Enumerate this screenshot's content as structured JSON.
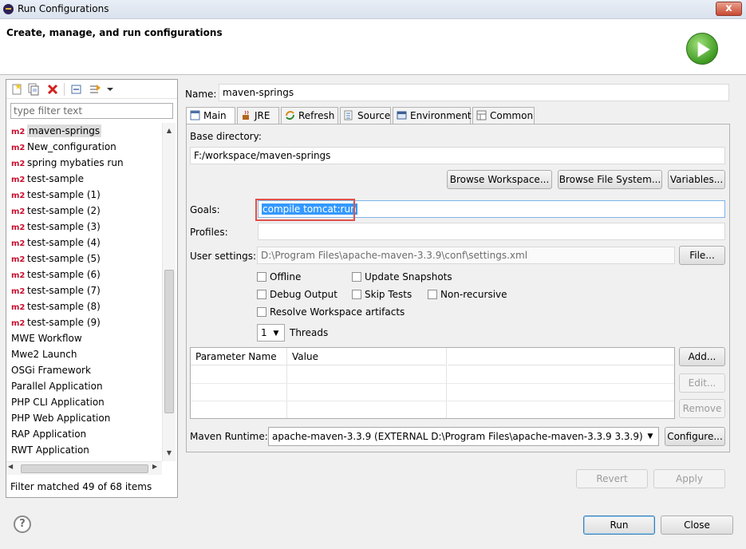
{
  "window": {
    "title": "Run Configurations",
    "close_glyph": "x"
  },
  "banner": {
    "title": "Create, manage, and run configurations"
  },
  "left": {
    "filter_placeholder": "type filter text",
    "items": [
      {
        "badge": "m2",
        "label": "maven-springs"
      },
      {
        "badge": "m2",
        "label": "New_configuration"
      },
      {
        "badge": "m2",
        "label": "spring mybaties run"
      },
      {
        "badge": "m2",
        "label": "test-sample"
      },
      {
        "badge": "m2",
        "label": "test-sample (1)"
      },
      {
        "badge": "m2",
        "label": "test-sample (2)"
      },
      {
        "badge": "m2",
        "label": "test-sample (3)"
      },
      {
        "badge": "m2",
        "label": "test-sample (4)"
      },
      {
        "badge": "m2",
        "label": "test-sample (5)"
      },
      {
        "badge": "m2",
        "label": "test-sample (6)"
      },
      {
        "badge": "m2",
        "label": "test-sample (7)"
      },
      {
        "badge": "m2",
        "label": "test-sample (8)"
      },
      {
        "badge": "m2",
        "label": "test-sample (9)"
      },
      {
        "badge": "",
        "label": "MWE Workflow"
      },
      {
        "badge": "",
        "label": "Mwe2 Launch"
      },
      {
        "badge": "",
        "label": "OSGi Framework"
      },
      {
        "badge": "",
        "label": "Parallel Application"
      },
      {
        "badge": "",
        "label": "PHP CLI Application"
      },
      {
        "badge": "",
        "label": "PHP Web Application"
      },
      {
        "badge": "",
        "label": "RAP Application"
      },
      {
        "badge": "",
        "label": "RWT Application"
      }
    ],
    "filter_status": "Filter matched 49 of 68 items"
  },
  "right": {
    "name_label": "Name:",
    "name_value": "maven-springs",
    "tabs": [
      "Main",
      "JRE",
      "Refresh",
      "Source",
      "Environment",
      "Common"
    ],
    "base_dir_label": "Base directory:",
    "base_dir_value": "F:/workspace/maven-springs",
    "browse_workspace": "Browse Workspace...",
    "browse_filesystem": "Browse File System...",
    "variables": "Variables...",
    "goals_label": "Goals:",
    "goals_value": "compile tomcat:run",
    "profiles_label": "Profiles:",
    "profiles_value": "",
    "user_settings_label": "User settings:",
    "user_settings_value": "D:\\Program Files\\apache-maven-3.3.9\\conf\\settings.xml",
    "file_button": "File...",
    "checkboxes": {
      "offline": "Offline",
      "update_snapshots": "Update Snapshots",
      "debug_output": "Debug Output",
      "skip_tests": "Skip Tests",
      "non_recursive": "Non-recursive",
      "resolve_workspace": "Resolve Workspace artifacts"
    },
    "threads_value": "1",
    "threads_label": "Threads",
    "param_header_name": "Parameter Name",
    "param_header_value": "Value",
    "add_button": "Add...",
    "edit_button": "Edit...",
    "remove_button": "Remove",
    "runtime_label": "Maven Runtime:",
    "runtime_value": "apache-maven-3.3.9 (EXTERNAL D:\\Program Files\\apache-maven-3.3.9 3.3.9)",
    "configure_button": "Configure...",
    "revert_button": "Revert",
    "apply_button": "Apply"
  },
  "footer": {
    "help": "?",
    "run_button": "Run",
    "close_button": "Close"
  }
}
